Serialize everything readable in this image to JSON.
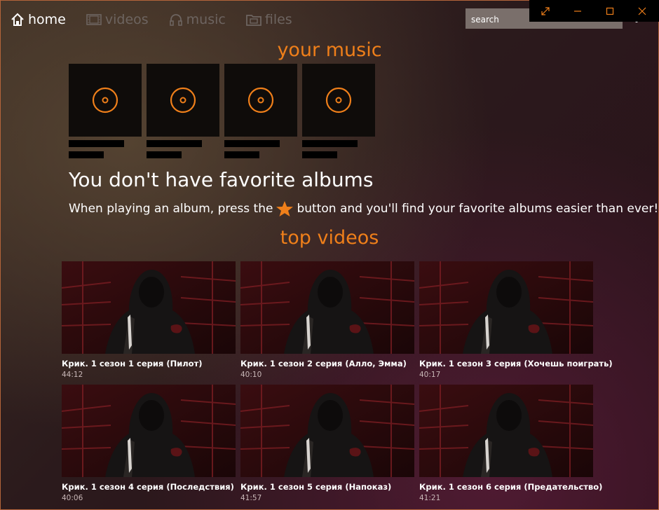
{
  "nav": {
    "items": [
      {
        "label": "home",
        "icon": "home-icon",
        "active": true
      },
      {
        "label": "videos",
        "icon": "film-icon",
        "active": false
      },
      {
        "label": "music",
        "icon": "headphones-icon",
        "active": false
      },
      {
        "label": "files",
        "icon": "folder-icon",
        "active": false
      }
    ]
  },
  "search": {
    "placeholder": "search"
  },
  "window_controls": [
    "fullscreen-icon",
    "minimize-icon",
    "maximize-icon",
    "close-icon"
  ],
  "music": {
    "title": "your music",
    "albums_count_placeholder": 4,
    "empty_title": "You don't have favorite albums",
    "empty_text_before": "When playing an album, press the",
    "empty_text_after": "button and you'll find your favorite albums easier than ever!"
  },
  "videos": {
    "title": "top videos",
    "items": [
      {
        "title": "Крик. 1 сезон 1 серия (Пилот)",
        "duration": "44:12"
      },
      {
        "title": "Крик. 1 сезон 2 серия (Алло, Эмма)",
        "duration": "40:10"
      },
      {
        "title": "Крик. 1 сезон 3 серия (Хочешь поиграть)",
        "duration": "40:17"
      },
      {
        "title": "Крик. 1 сезон 4 серия (Последствия)",
        "duration": "40:06"
      },
      {
        "title": "Крик. 1 сезон 5 серия (Напоказ)",
        "duration": "41:57"
      },
      {
        "title": "Крик. 1 сезон 6 серия (Предательство)",
        "duration": "41:21"
      }
    ]
  },
  "colors": {
    "accent": "#ef7f1a",
    "border": "#b4643a"
  }
}
